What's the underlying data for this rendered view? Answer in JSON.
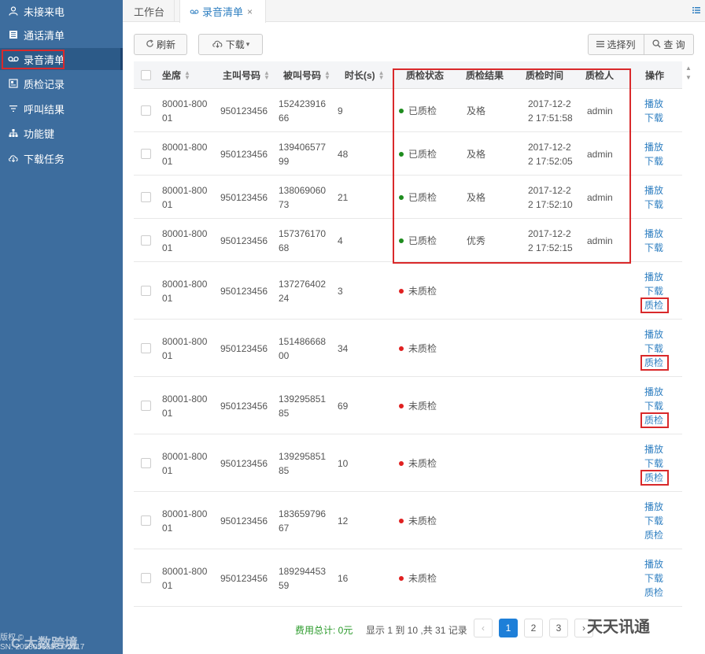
{
  "sidebar": {
    "items": [
      {
        "label": "未接来电",
        "icon": "person-icon"
      },
      {
        "label": "通话清单",
        "icon": "list-icon"
      },
      {
        "label": "录音清单",
        "icon": "voicemail-icon",
        "active": true
      },
      {
        "label": "质检记录",
        "icon": "record-icon"
      },
      {
        "label": "呼叫结果",
        "icon": "filter-icon"
      },
      {
        "label": "功能键",
        "icon": "sitemap-icon"
      },
      {
        "label": "下载任务",
        "icon": "cloud-download-icon"
      }
    ],
    "footer_line1": "版权 ©",
    "footer_line2": "SN: 2058053253 ©2017",
    "watermark": "C 大数跨境"
  },
  "tabs": [
    {
      "label": "工作台",
      "active": false
    },
    {
      "label": "录音清单",
      "active": true,
      "close": "×"
    }
  ],
  "toolbar": {
    "refresh_label": "刷新",
    "download_label": "下载",
    "select_columns_label": "选择列",
    "query_label": "查 询"
  },
  "table": {
    "columns": [
      "坐席",
      "主叫号码",
      "被叫号码",
      "时长(s)",
      "质检状态",
      "质检结果",
      "质检时间",
      "质检人",
      "操作"
    ],
    "rows": [
      {
        "agent": [
          "80001-800",
          "01"
        ],
        "caller": "950123456",
        "callee": [
          "152423916",
          "66"
        ],
        "duration": "9",
        "status": "已质检",
        "status_color": "green",
        "result": "及格",
        "time": [
          "2017-12-2",
          "2 17:51:58"
        ],
        "inspector": "admin",
        "ops": [
          "播放",
          "下载"
        ]
      },
      {
        "agent": [
          "80001-800",
          "01"
        ],
        "caller": "950123456",
        "callee": [
          "139406577",
          "99"
        ],
        "duration": "48",
        "status": "已质检",
        "status_color": "green",
        "result": "及格",
        "time": [
          "2017-12-2",
          "2 17:52:05"
        ],
        "inspector": "admin",
        "ops": [
          "播放",
          "下载"
        ]
      },
      {
        "agent": [
          "80001-800",
          "01"
        ],
        "caller": "950123456",
        "callee": [
          "138069060",
          "73"
        ],
        "duration": "21",
        "status": "已质检",
        "status_color": "green",
        "result": "及格",
        "time": [
          "2017-12-2",
          "2 17:52:10"
        ],
        "inspector": "admin",
        "ops": [
          "播放",
          "下载"
        ]
      },
      {
        "agent": [
          "80001-800",
          "01"
        ],
        "caller": "950123456",
        "callee": [
          "157376170",
          "68"
        ],
        "duration": "4",
        "status": "已质检",
        "status_color": "green",
        "result": "优秀",
        "time": [
          "2017-12-2",
          "2 17:52:15"
        ],
        "inspector": "admin",
        "ops": [
          "播放",
          "下载"
        ]
      },
      {
        "agent": [
          "80001-800",
          "01"
        ],
        "caller": "950123456",
        "callee": [
          "137276402",
          "24"
        ],
        "duration": "3",
        "status": "未质检",
        "status_color": "red",
        "result": "",
        "time": [
          "",
          ""
        ],
        "inspector": "",
        "ops": [
          "播放",
          "下载",
          "质检"
        ]
      },
      {
        "agent": [
          "80001-800",
          "01"
        ],
        "caller": "950123456",
        "callee": [
          "151486668",
          "00"
        ],
        "duration": "34",
        "status": "未质检",
        "status_color": "red",
        "result": "",
        "time": [
          "",
          ""
        ],
        "inspector": "",
        "ops": [
          "播放",
          "下载",
          "质检"
        ]
      },
      {
        "agent": [
          "80001-800",
          "01"
        ],
        "caller": "950123456",
        "callee": [
          "139295851",
          "85"
        ],
        "duration": "69",
        "status": "未质检",
        "status_color": "red",
        "result": "",
        "time": [
          "",
          ""
        ],
        "inspector": "",
        "ops": [
          "播放",
          "下载",
          "质检"
        ]
      },
      {
        "agent": [
          "80001-800",
          "01"
        ],
        "caller": "950123456",
        "callee": [
          "139295851",
          "85"
        ],
        "duration": "10",
        "status": "未质检",
        "status_color": "red",
        "result": "",
        "time": [
          "",
          ""
        ],
        "inspector": "",
        "ops": [
          "播放",
          "下载",
          "质检"
        ]
      },
      {
        "agent": [
          "80001-800",
          "01"
        ],
        "caller": "950123456",
        "callee": [
          "183659796",
          "67"
        ],
        "duration": "12",
        "status": "未质检",
        "status_color": "red",
        "result": "",
        "time": [
          "",
          ""
        ],
        "inspector": "",
        "ops": [
          "播放",
          "下载",
          "质检"
        ]
      },
      {
        "agent": [
          "80001-800",
          "01"
        ],
        "caller": "950123456",
        "callee": [
          "189294453",
          "59"
        ],
        "duration": "16",
        "status": "未质检",
        "status_color": "red",
        "result": "",
        "time": [
          "",
          ""
        ],
        "inspector": "",
        "ops": [
          "播放",
          "下载",
          "质检"
        ]
      }
    ]
  },
  "footer": {
    "total_label": "费用总计: 0元",
    "range_label": "显示 1 到 10 ,共 31 记录",
    "pages": [
      "1",
      "2",
      "3"
    ],
    "current_page": "1",
    "prev": "‹",
    "next": "›",
    "watermark": "天天讯通"
  },
  "colors": {
    "sidebar_bg": "#3d6d9e",
    "link": "#2f7fc1",
    "highlight": "#d9292b",
    "ok": "#1e8c1e",
    "pending": "#e02020"
  }
}
